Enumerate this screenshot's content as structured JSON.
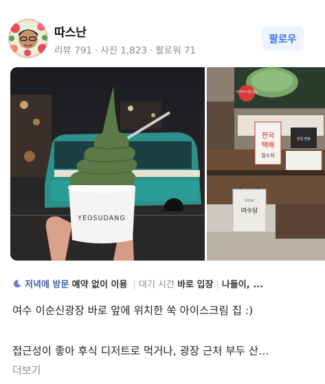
{
  "reviewer": {
    "name": "따스난",
    "reviews_label": "리뷰 791",
    "photos_label": "사진 1,823",
    "followers_label": "팔로워 71",
    "separator": "·"
  },
  "follow_button": {
    "label": "팔로우"
  },
  "photo_left": {
    "cup_text": "YEOSUDANG"
  },
  "photo_right": {
    "sign_red_text": "쑥아이스크림 맛집",
    "sign_board_lines": [
      "전국",
      "택배",
      "접수처"
    ],
    "sign_small_text": "당일 발송",
    "bag_top": "YEOSU",
    "bag_main": "여수당"
  },
  "tags": {
    "visit_time": "저녁에 방문",
    "reservation": "예약 없이 이용",
    "wait_label": "대기 시간",
    "wait_value": "바로 입장",
    "truncated": "나들이, ...",
    "separator": "|"
  },
  "description": {
    "line1": "여수 이순신광장 바로 앞에 위치한 쑥 아이스크림 집 :)",
    "line2": "접근성이 좋아 후식 디저트로 먹거나, 광장 근처 부두 산…",
    "more_label": "더보기"
  },
  "colors": {
    "accent": "#3a6ff0",
    "tag_blue": "#4a5fa8",
    "matcha": "#5b7a48"
  }
}
